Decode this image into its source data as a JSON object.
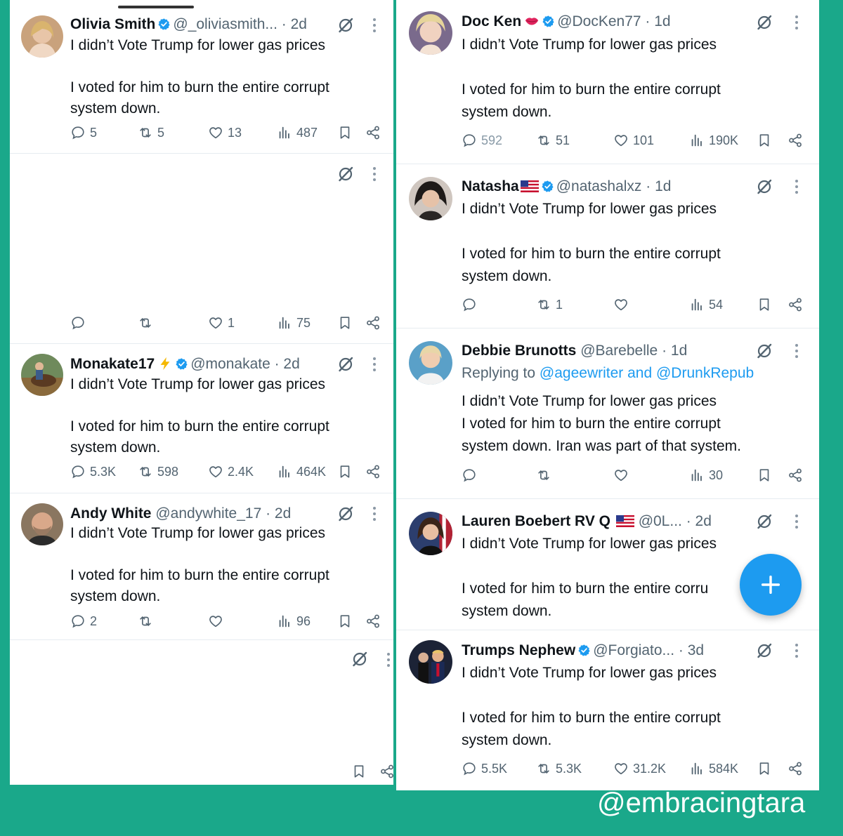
{
  "left": {
    "tweets": [
      {
        "name": "Olivia Smith",
        "handle": "@_oliviasmith...",
        "time": "· 2d",
        "text": "I didn’t Vote Trump for lower gas prices\n\nI voted for him to burn the entire corrupt\nsystem down.",
        "replies": "5",
        "reposts": "5",
        "likes": "13",
        "views": "487"
      },
      {
        "name": "",
        "handle": "",
        "time": "",
        "text": "",
        "replies": "",
        "reposts": "",
        "likes": "1",
        "views": "75"
      },
      {
        "name": "Monakate17",
        "handle": "@monakate",
        "time": "· 2d",
        "text": "I didn’t Vote Trump for lower gas prices\n\nI voted for him to burn the entire corrupt\nsystem down.",
        "replies": "5.3K",
        "reposts": "598",
        "likes": "2.4K",
        "views": "464K"
      },
      {
        "name": "Andy White",
        "handle": "@andywhite_17",
        "time": "· 2d",
        "text": "I didn’t Vote Trump for lower gas prices\n\nI voted for him to burn the entire corrupt\nsystem down.",
        "replies": "2",
        "reposts": "",
        "likes": "",
        "views": "96"
      }
    ]
  },
  "right": {
    "tweets": [
      {
        "name": "Doc Ken",
        "handle": "@DocKen77",
        "time": "· 1d",
        "text": "I didn’t Vote Trump for lower gas prices\n\nI voted for him to burn the entire corrupt\nsystem down.",
        "replies": "592",
        "reposts": "51",
        "likes": "101",
        "views": "190K"
      },
      {
        "name": "Natasha",
        "handle": "@natashalxz",
        "time": "· 1d",
        "text": "I didn’t Vote Trump for lower gas prices\n\nI voted for him to burn the entire corrupt\nsystem down.",
        "replies": "",
        "reposts": "1",
        "likes": "",
        "views": "54"
      },
      {
        "name": "Debbie Brunotts",
        "handle": "@Barebelle",
        "time": "· 1d",
        "reply_prefix": "Replying to ",
        "reply_to": "@ageewriter and @DrunkRepub",
        "text": "I didn’t Vote Trump for lower gas prices\nI voted for him to burn the entire corrupt\nsystem down.  Iran was part of that system.",
        "replies": "",
        "reposts": "",
        "likes": "",
        "views": "30"
      },
      {
        "name": "Lauren Boebert RV Q",
        "handle": "@0L...",
        "time": "· 2d",
        "text": "I didn’t Vote Trump for lower gas prices\n\nI voted for him to burn the entire corru\nsystem down."
      },
      {
        "name": "Trumps Nephew",
        "handle": "@Forgiato...",
        "time": "· 3d",
        "text": "I didn’t Vote Trump for lower gas prices\n\nI voted for him to burn the entire corrupt\nsystem down.",
        "replies": "5.5K",
        "reposts": "5.3K",
        "likes": "31.2K",
        "views": "584K"
      }
    ]
  },
  "watermark": "@embracingtara",
  "colors": {
    "background": "#1aa88a",
    "accent": "#1d9bf0",
    "muted": "#536471",
    "verified": "#1d9bf0"
  },
  "icons": [
    "reply-icon",
    "repost-icon",
    "like-icon",
    "views-icon",
    "bookmark-icon",
    "share-icon",
    "grok-icon",
    "more-icon",
    "verified-badge-icon",
    "compose-icon"
  ]
}
